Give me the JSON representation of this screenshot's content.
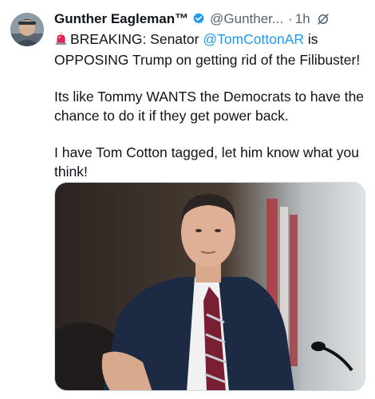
{
  "author": {
    "display_name": "Gunther Eagleman™",
    "handle": "@Gunther...",
    "separator": "·",
    "timestamp": "1h"
  },
  "tweet": {
    "line1_prefix": "BREAKING: Senator ",
    "mention": "@TomCottonAR",
    "line1_suffix": " is OPPOSING Trump on getting rid of the Filibuster!",
    "paragraph2": "Its like Tommy WANTS the Democrats to have the chance to do it if they get power back.",
    "paragraph3": "I have Tom Cotton tagged, let him know what you think!"
  },
  "icons": {
    "avatar": "avatar-icon",
    "verified": "verified-badge-icon",
    "grok": "grok-icon",
    "siren": "siren-emoji-icon"
  },
  "colors": {
    "link": "#1d9bf0",
    "secondary_text": "#536471",
    "verified": "#1d9bf0"
  }
}
